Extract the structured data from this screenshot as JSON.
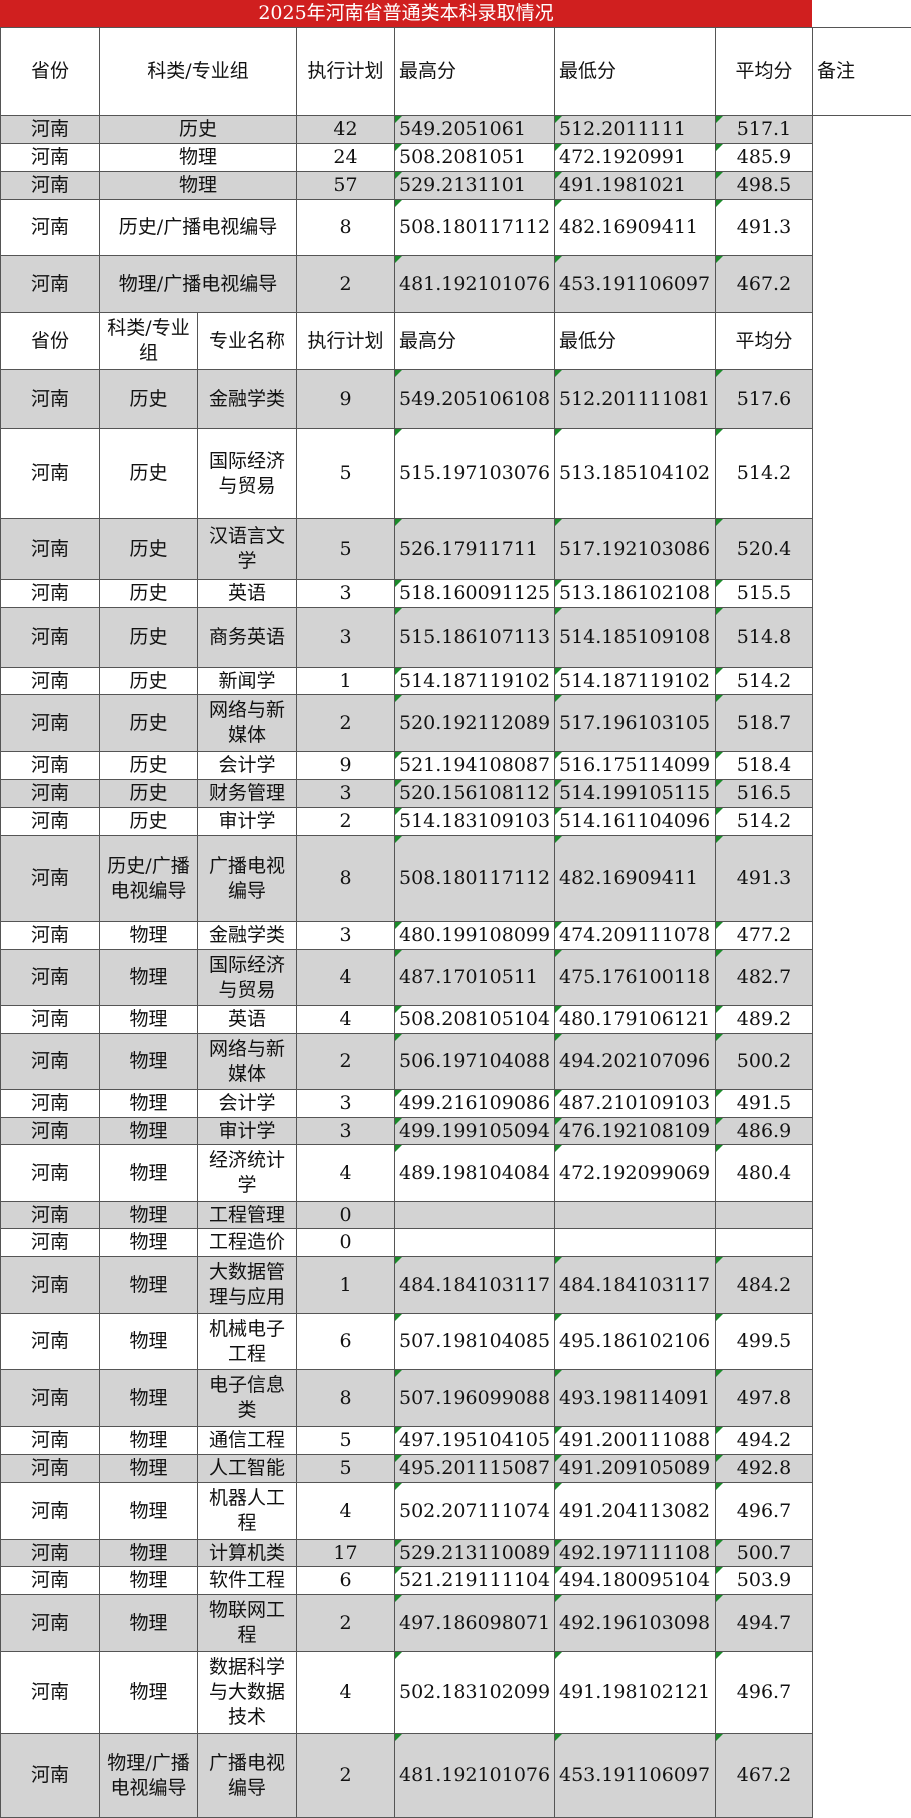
{
  "title": "2025年河南省普通类本科录取情况",
  "header1": {
    "province": "省份",
    "category": "科类/专业组",
    "plan": "执行计划",
    "max": "最高分",
    "min": "最低分",
    "avg": "平均分",
    "note": "备注"
  },
  "table1": [
    {
      "province": "河南",
      "category": "历史",
      "plan": "42",
      "max": "549.2051061",
      "min": "512.2011111",
      "avg": "517.1"
    },
    {
      "province": "河南",
      "category": "物理",
      "plan": "24",
      "max": "508.2081051",
      "min": "472.1920991",
      "avg": "485.9"
    },
    {
      "province": "河南",
      "category": "物理",
      "plan": "57",
      "max": "529.2131101",
      "min": "491.1981021",
      "avg": "498.5"
    },
    {
      "province": "河南",
      "category": "历史/广播电视编导",
      "plan": "8",
      "max": "508.180117112",
      "min": "482.16909411",
      "avg": "491.3"
    },
    {
      "province": "河南",
      "category": "物理/广播电视编导",
      "plan": "2",
      "max": "481.192101076",
      "min": "453.191106097",
      "avg": "467.2"
    }
  ],
  "header2": {
    "province": "省份",
    "category": "科类/专业组",
    "major": "专业名称",
    "plan": "执行计划",
    "max": "最高分",
    "min": "最低分",
    "avg": "平均分"
  },
  "table2": [
    {
      "province": "河南",
      "category": "历史",
      "major": "金融学类",
      "plan": "9",
      "max": "549.205106108",
      "min": "512.201111081",
      "avg": "517.6"
    },
    {
      "province": "河南",
      "category": "历史",
      "major": "国际经济与贸易",
      "plan": "5",
      "max": "515.197103076",
      "min": "513.185104102",
      "avg": "514.2"
    },
    {
      "province": "河南",
      "category": "历史",
      "major": "汉语言文学",
      "plan": "5",
      "max": "526.17911711",
      "min": "517.192103086",
      "avg": "520.4"
    },
    {
      "province": "河南",
      "category": "历史",
      "major": "英语",
      "plan": "3",
      "max": "518.160091125",
      "min": "513.186102108",
      "avg": "515.5"
    },
    {
      "province": "河南",
      "category": "历史",
      "major": "商务英语",
      "plan": "3",
      "max": "515.186107113",
      "min": "514.185109108",
      "avg": "514.8"
    },
    {
      "province": "河南",
      "category": "历史",
      "major": "新闻学",
      "plan": "1",
      "max": "514.187119102",
      "min": "514.187119102",
      "avg": "514.2"
    },
    {
      "province": "河南",
      "category": "历史",
      "major": "网络与新媒体",
      "plan": "2",
      "max": "520.192112089",
      "min": "517.196103105",
      "avg": "518.7"
    },
    {
      "province": "河南",
      "category": "历史",
      "major": "会计学",
      "plan": "9",
      "max": "521.194108087",
      "min": "516.175114099",
      "avg": "518.4"
    },
    {
      "province": "河南",
      "category": "历史",
      "major": "财务管理",
      "plan": "3",
      "max": "520.156108112",
      "min": "514.199105115",
      "avg": "516.5"
    },
    {
      "province": "河南",
      "category": "历史",
      "major": "审计学",
      "plan": "2",
      "max": "514.183109103",
      "min": "514.161104096",
      "avg": "514.2"
    },
    {
      "province": "河南",
      "category": "历史/广播电视编导",
      "major": "广播电视编导",
      "plan": "8",
      "max": "508.180117112",
      "min": "482.16909411",
      "avg": "491.3"
    },
    {
      "province": "河南",
      "category": "物理",
      "major": "金融学类",
      "plan": "3",
      "max": "480.199108099",
      "min": "474.209111078",
      "avg": "477.2"
    },
    {
      "province": "河南",
      "category": "物理",
      "major": "国际经济与贸易",
      "plan": "4",
      "max": "487.17010511",
      "min": "475.176100118",
      "avg": "482.7"
    },
    {
      "province": "河南",
      "category": "物理",
      "major": "英语",
      "plan": "4",
      "max": "508.208105104",
      "min": "480.179106121",
      "avg": "489.2"
    },
    {
      "province": "河南",
      "category": "物理",
      "major": "网络与新媒体",
      "plan": "2",
      "max": "506.197104088",
      "min": "494.202107096",
      "avg": "500.2"
    },
    {
      "province": "河南",
      "category": "物理",
      "major": "会计学",
      "plan": "3",
      "max": "499.216109086",
      "min": "487.210109103",
      "avg": "491.5"
    },
    {
      "province": "河南",
      "category": "物理",
      "major": "审计学",
      "plan": "3",
      "max": "499.199105094",
      "min": "476.192108109",
      "avg": "486.9"
    },
    {
      "province": "河南",
      "category": "物理",
      "major": "经济统计学",
      "plan": "4",
      "max": "489.198104084",
      "min": "472.192099069",
      "avg": "480.4"
    },
    {
      "province": "河南",
      "category": "物理",
      "major": "工程管理",
      "plan": "0",
      "max": "",
      "min": "",
      "avg": ""
    },
    {
      "province": "河南",
      "category": "物理",
      "major": "工程造价",
      "plan": "0",
      "max": "",
      "min": "",
      "avg": ""
    },
    {
      "province": "河南",
      "category": "物理",
      "major": "大数据管理与应用",
      "plan": "1",
      "max": "484.184103117",
      "min": "484.184103117",
      "avg": "484.2"
    },
    {
      "province": "河南",
      "category": "物理",
      "major": "机械电子工程",
      "plan": "6",
      "max": "507.198104085",
      "min": "495.186102106",
      "avg": "499.5"
    },
    {
      "province": "河南",
      "category": "物理",
      "major": "电子信息类",
      "plan": "8",
      "max": "507.196099088",
      "min": "493.198114091",
      "avg": "497.8"
    },
    {
      "province": "河南",
      "category": "物理",
      "major": "通信工程",
      "plan": "5",
      "max": "497.195104105",
      "min": "491.200111088",
      "avg": "494.2"
    },
    {
      "province": "河南",
      "category": "物理",
      "major": "人工智能",
      "plan": "5",
      "max": "495.201115087",
      "min": "491.209105089",
      "avg": "492.8"
    },
    {
      "province": "河南",
      "category": "物理",
      "major": "机器人工程",
      "plan": "4",
      "max": "502.207111074",
      "min": "491.204113082",
      "avg": "496.7"
    },
    {
      "province": "河南",
      "category": "物理",
      "major": "计算机类",
      "plan": "17",
      "max": "529.213110089",
      "min": "492.197111108",
      "avg": "500.7"
    },
    {
      "province": "河南",
      "category": "物理",
      "major": "软件工程",
      "plan": "6",
      "max": "521.219111104",
      "min": "494.180095104",
      "avg": "503.9"
    },
    {
      "province": "河南",
      "category": "物理",
      "major": "物联网工程",
      "plan": "2",
      "max": "497.186098071",
      "min": "492.196103098",
      "avg": "494.7"
    },
    {
      "province": "河南",
      "category": "物理",
      "major": "数据科学与大数据技术",
      "plan": "4",
      "max": "502.183102099",
      "min": "491.198102121",
      "avg": "496.7"
    },
    {
      "province": "河南",
      "category": "物理/广播电视编导",
      "major": "广播电视编导",
      "plan": "2",
      "max": "481.192101076",
      "min": "453.191106097",
      "avg": "467.2"
    }
  ]
}
